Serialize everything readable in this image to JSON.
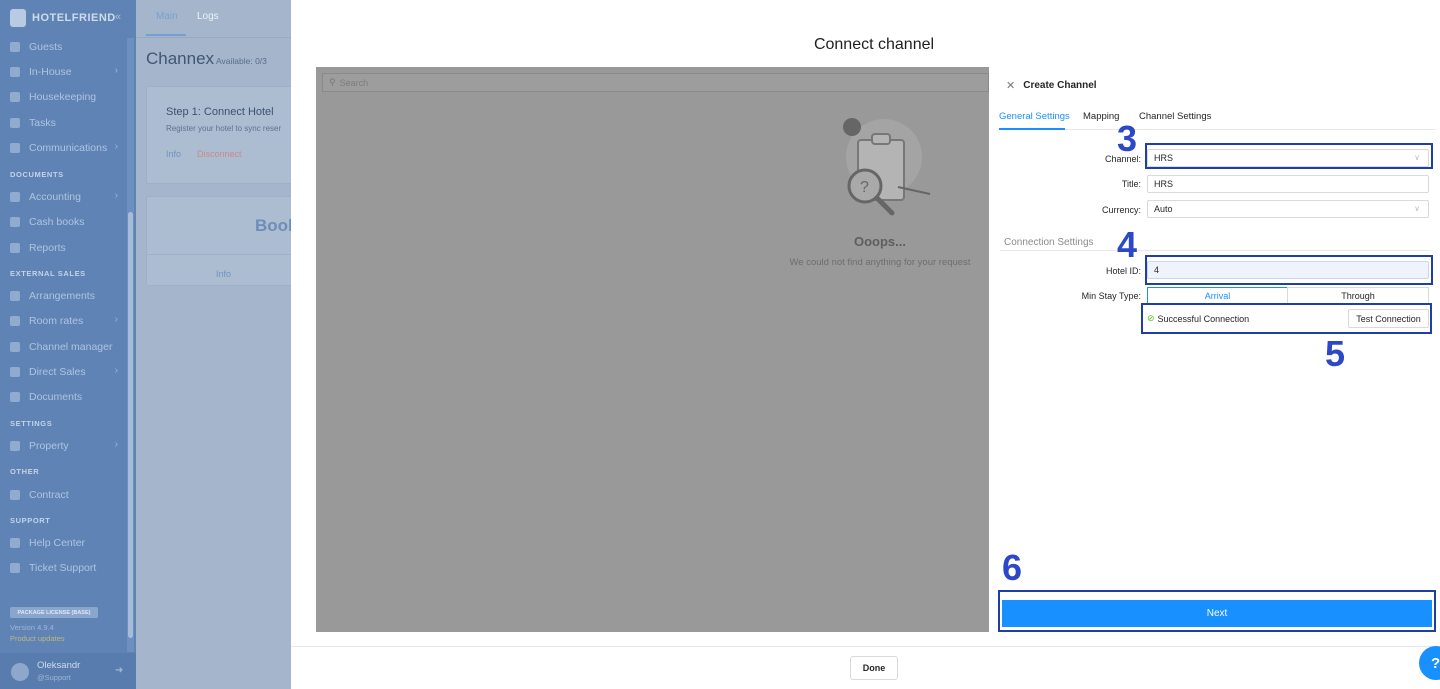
{
  "sidebar": {
    "logo": "HOTELFRIEND",
    "collapse_icon": "«",
    "items": [
      {
        "label": "Guests",
        "icon": "person-icon",
        "chevron": false
      },
      {
        "label": "In-House",
        "icon": "bed-icon",
        "chevron": true
      },
      {
        "label": "Housekeeping",
        "icon": "broom-icon",
        "chevron": false
      },
      {
        "label": "Tasks",
        "icon": "wrench-icon",
        "chevron": false
      },
      {
        "label": "Communications",
        "icon": "chat-icon",
        "chevron": true
      },
      {
        "label": "Accounting",
        "icon": "calculator-icon",
        "chevron": true
      },
      {
        "label": "Cash books",
        "icon": "book-icon",
        "chevron": false
      },
      {
        "label": "Reports",
        "icon": "report-icon",
        "chevron": false
      },
      {
        "label": "Arrangements",
        "icon": "tag-icon",
        "chevron": false
      },
      {
        "label": "Room rates",
        "icon": "chart-icon",
        "chevron": true
      },
      {
        "label": "Channel manager",
        "icon": "network-icon",
        "chevron": false
      },
      {
        "label": "Direct Sales",
        "icon": "monitor-icon",
        "chevron": true
      },
      {
        "label": "Documents",
        "icon": "folder-icon",
        "chevron": false
      },
      {
        "label": "Property",
        "icon": "gear-icon",
        "chevron": true
      },
      {
        "label": "Contract",
        "icon": "contract-icon",
        "chevron": false
      },
      {
        "label": "Help Center",
        "icon": "help-icon",
        "chevron": false
      },
      {
        "label": "Ticket Support",
        "icon": "ticket-icon",
        "chevron": false
      }
    ],
    "sections": {
      "documents": "DOCUMENTS",
      "external_sales": "EXTERNAL SALES",
      "settings": "SETTINGS",
      "other": "OTHER",
      "support": "SUPPORT"
    },
    "license": "PACKAGE LICENSE (BASE)",
    "version": "Version 4.9.4",
    "updates": "Product updates",
    "user": {
      "name": "Oleksandr",
      "role": "@Support"
    }
  },
  "main": {
    "tabs": [
      "Main",
      "Logs"
    ],
    "title": "Channex",
    "available": "Available: 0/3",
    "step1_title": "Step 1: Connect Hotel",
    "step1_desc": "Register your hotel to sync reser",
    "info": "Info",
    "disconnect": "Disconnect",
    "booking_partial": "Book",
    "info2": "Info"
  },
  "modal": {
    "title": "Connect channel",
    "search_placeholder": "Search",
    "empty_title": "Ooops...",
    "empty_sub": "We could not find anything for your request",
    "done": "Done",
    "help": "?"
  },
  "panel": {
    "header": "Create Channel",
    "tabs": [
      "General Settings",
      "Mapping",
      "Channel Settings"
    ],
    "fields": {
      "channel_label": "Channel:",
      "channel_value": "HRS",
      "title_label": "Title:",
      "title_value": "HRS",
      "currency_label": "Currency:",
      "currency_value": "Auto"
    },
    "connection_section": "Connection Settings",
    "hotel_id_label": "Hotel ID:",
    "hotel_id_value": "4",
    "min_stay_label": "Min Stay Type:",
    "min_stay_options": [
      "Arrival",
      "Through"
    ],
    "status": "Successful Connection",
    "test_button": "Test Connection",
    "next": "Next"
  },
  "annotations": [
    "3",
    "4",
    "5",
    "6"
  ],
  "colors": {
    "accent": "#1890ff",
    "annotation": "#2b49c7",
    "sidebar": "#5f83b5"
  }
}
